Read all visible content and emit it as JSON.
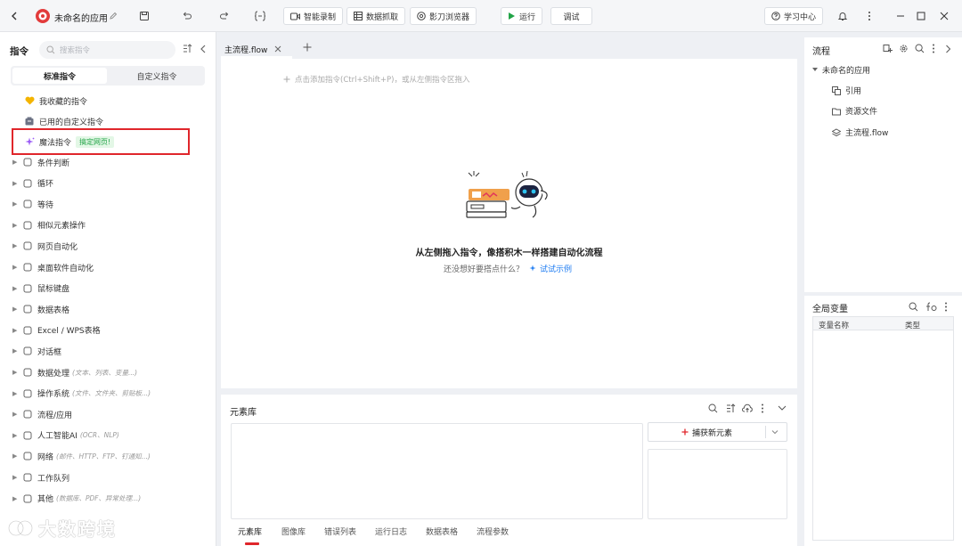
{
  "titlebar": {
    "app_name": "未命名的应用",
    "smart_record": "智能录制",
    "data_capture": "数据抓取",
    "browser": "影刀浏览器",
    "run": "运行",
    "debug": "调试",
    "learn": "学习中心"
  },
  "left": {
    "title": "指令",
    "search_placeholder": "搜索指令",
    "tab_standard": "标准指令",
    "tab_custom": "自定义指令",
    "favorites": "我收藏的指令",
    "used_custom": "已用的自定义指令",
    "magic": "魔法指令",
    "magic_badge": "搞定网页!",
    "categories": [
      {
        "label": "条件判断",
        "hint": ""
      },
      {
        "label": "循环",
        "hint": ""
      },
      {
        "label": "等待",
        "hint": ""
      },
      {
        "label": "相似元素操作",
        "hint": ""
      },
      {
        "label": "网页自动化",
        "hint": ""
      },
      {
        "label": "桌面软件自动化",
        "hint": ""
      },
      {
        "label": "鼠标键盘",
        "hint": ""
      },
      {
        "label": "数据表格",
        "hint": ""
      },
      {
        "label": "Excel / WPS表格",
        "hint": ""
      },
      {
        "label": "对话框",
        "hint": ""
      },
      {
        "label": "数据处理",
        "hint": "(文本、列表、变量...)"
      },
      {
        "label": "操作系统",
        "hint": "(文件、文件夹、剪贴板...)"
      },
      {
        "label": "流程/应用",
        "hint": ""
      },
      {
        "label": "人工智能AI",
        "hint": "(OCR、NLP)"
      },
      {
        "label": "网络",
        "hint": "(邮件、HTTP、FTP、钉通知...)"
      },
      {
        "label": "工作队列",
        "hint": ""
      },
      {
        "label": "其他",
        "hint": "(数据库、PDF、异常处理...)"
      }
    ]
  },
  "center": {
    "tab_name": "主流程.flow",
    "add_hint": "点击添加指令(Ctrl+Shift+P)，或从左侧指令区拖入",
    "empty_title": "从左侧拖入指令，像搭积木一样搭建自动化流程",
    "empty_sub": "还没想好要搭点什么？",
    "try_example": "试试示例"
  },
  "elements": {
    "title": "元素库",
    "capture": "捕获新元素",
    "tabs": [
      "元素库",
      "图像库",
      "错误列表",
      "运行日志",
      "数据表格",
      "流程参数"
    ]
  },
  "flow": {
    "title": "流程",
    "root": "未命名的应用",
    "items": [
      "引用",
      "资源文件",
      "主流程.flow"
    ]
  },
  "vars": {
    "title": "全局变量",
    "col_name": "变量名称",
    "col_type": "类型"
  },
  "watermark": "大数跨境",
  "colors": {
    "accent": "#1e7cf2",
    "run_green": "#22a447",
    "magic_badge_bg": "#e3f7e6",
    "highlight": "#e0262b"
  }
}
